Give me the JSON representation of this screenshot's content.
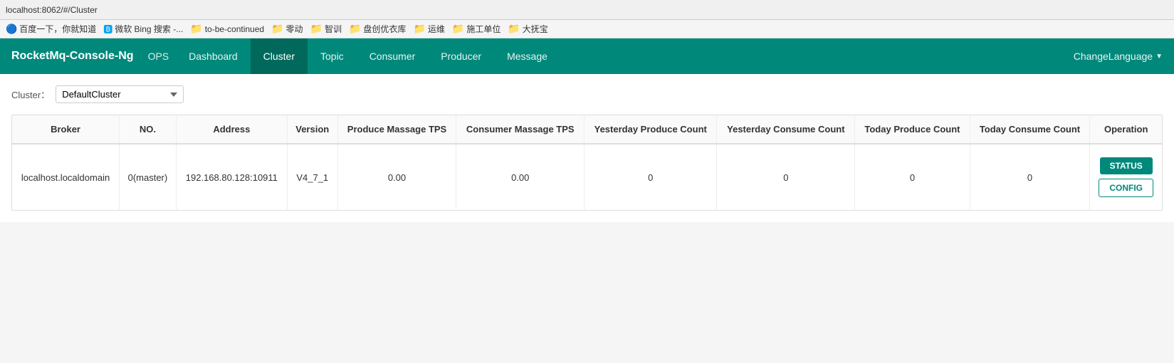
{
  "browser": {
    "url": "localhost:8062/#/Cluster"
  },
  "bookmarks": [
    {
      "label": "百度一下，你就知道",
      "type": "site",
      "color": "#4285f4"
    },
    {
      "label": "微软 Bing 搜索 -...",
      "type": "site",
      "color": "#00a4ef"
    },
    {
      "label": "to-be-continued",
      "type": "folder"
    },
    {
      "label": "零动",
      "type": "folder"
    },
    {
      "label": "智训",
      "type": "folder"
    },
    {
      "label": "盘创优衣库",
      "type": "folder"
    },
    {
      "label": "运维",
      "type": "folder"
    },
    {
      "label": "施工单位",
      "type": "folder"
    },
    {
      "label": "大抚宝",
      "type": "folder"
    }
  ],
  "navbar": {
    "brand": "RocketMq-Console-Ng",
    "ops_label": "OPS",
    "nav_items": [
      {
        "label": "Dashboard",
        "active": false
      },
      {
        "label": "Cluster",
        "active": true
      },
      {
        "label": "Topic",
        "active": false
      },
      {
        "label": "Consumer",
        "active": false
      },
      {
        "label": "Producer",
        "active": false
      },
      {
        "label": "Message",
        "active": false
      }
    ],
    "change_language": "ChangeLanguage"
  },
  "cluster_selector": {
    "label": "Cluster：",
    "options": [
      "DefaultCluster"
    ],
    "selected": "DefaultCluster"
  },
  "table": {
    "headers": [
      "Broker",
      "NO.",
      "Address",
      "Version",
      "Produce Massage TPS",
      "Consumer Massage TPS",
      "Yesterday Produce Count",
      "Yesterday Consume Count",
      "Today Produce Count",
      "Today Consume Count",
      "Operation"
    ],
    "rows": [
      {
        "broker": "localhost.localdomain",
        "no": "0(master)",
        "address": "192.168.80.128:10911",
        "version": "V4_7_1",
        "produce_tps": "0.00",
        "consumer_tps": "0.00",
        "yesterday_produce": "0",
        "yesterday_consume": "0",
        "today_produce": "0",
        "today_consume": "0"
      }
    ]
  },
  "buttons": {
    "status": "STATUS",
    "config": "CONFIG"
  }
}
